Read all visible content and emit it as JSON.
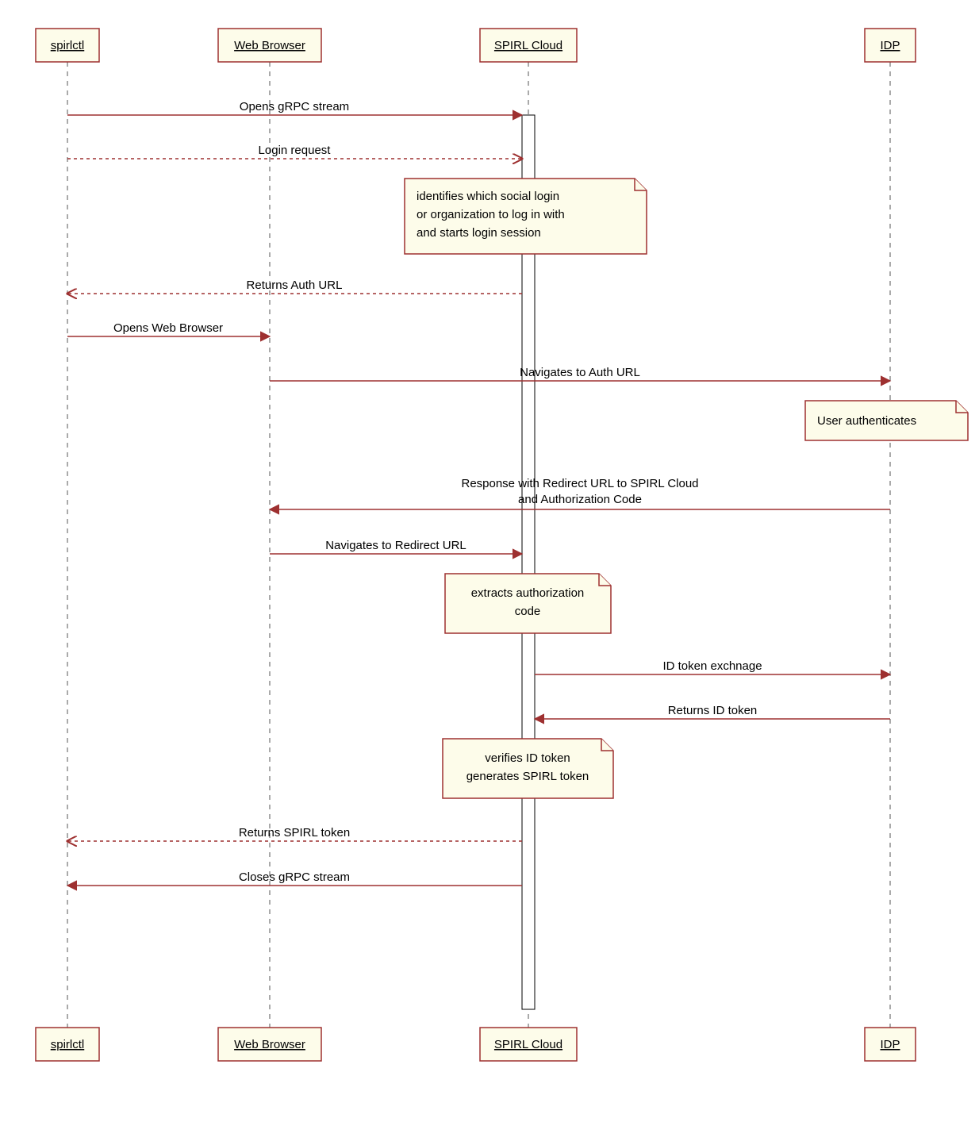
{
  "actors": {
    "a1": "spirlctl",
    "a2": "Web Browser",
    "a3": "SPIRL Cloud",
    "a4": "IDP"
  },
  "messages": {
    "m1": "Opens gRPC stream",
    "m2": "Login request",
    "m3": "Returns Auth URL",
    "m4": "Opens Web Browser",
    "m5": "Navigates to Auth URL",
    "m6a": "Response with Redirect URL to SPIRL Cloud",
    "m6b": "and Authorization Code",
    "m7": "Navigates to Redirect URL",
    "m8": "ID token exchnage",
    "m9": "Returns ID token",
    "m10": "Returns SPIRL token",
    "m11": "Closes gRPC stream"
  },
  "notes": {
    "n1a": "identifies which social login",
    "n1b": "or organization to log in with",
    "n1c": "and starts login session",
    "n2": "User authenticates",
    "n3a": "extracts authorization",
    "n3b": "code",
    "n4a": "verifies ID token",
    "n4b": "generates SPIRL token"
  }
}
